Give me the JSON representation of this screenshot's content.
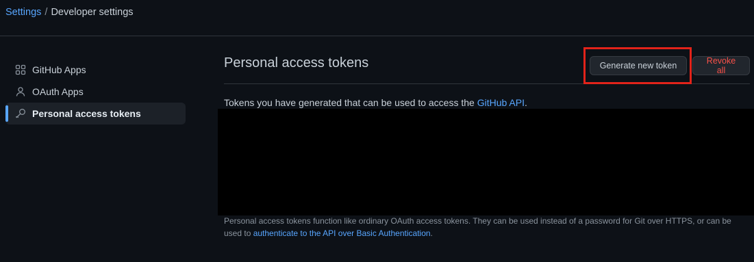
{
  "breadcrumb": {
    "root": "Settings",
    "separator": "/",
    "current": "Developer settings"
  },
  "sidebar": {
    "items": [
      {
        "label": "GitHub Apps",
        "icon": "apps-grid-icon",
        "active": false
      },
      {
        "label": "OAuth Apps",
        "icon": "person-icon",
        "active": false
      },
      {
        "label": "Personal access tokens",
        "icon": "key-icon",
        "active": true
      }
    ]
  },
  "main": {
    "title": "Personal access tokens",
    "generate_button": "Generate new token",
    "revoke_button": "Revoke all",
    "description_prefix": "Tokens you have generated that can be used to access the ",
    "description_link": "GitHub API",
    "description_suffix": ".",
    "footnote_text": "Personal access tokens function like ordinary OAuth access tokens. They can be used instead of a password for Git over HTTPS, or can be used to ",
    "footnote_link": "authenticate to the API over Basic Authentication",
    "footnote_suffix": "."
  },
  "colors": {
    "background": "#0d1117",
    "accent": "#58a6ff",
    "danger": "#f85149",
    "highlight_box": "#e2231a"
  }
}
